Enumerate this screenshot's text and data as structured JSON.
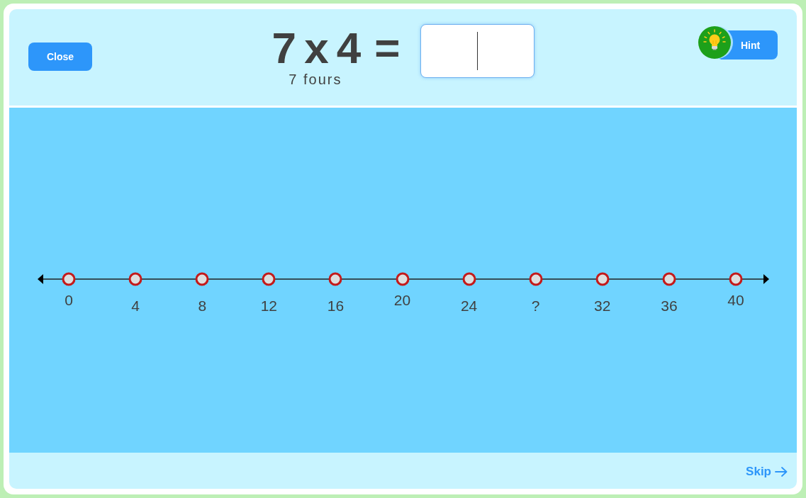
{
  "close_button": {
    "label": "Close"
  },
  "question": {
    "expression": "7 x 4",
    "equals": "=",
    "subtitle": "7 fours"
  },
  "answer_field": {
    "focused": true
  },
  "hint_button": {
    "label": "Hint"
  },
  "number_line": {
    "points": [
      {
        "label": "0",
        "kind": "major"
      },
      {
        "label": "4",
        "kind": "minor"
      },
      {
        "label": "8",
        "kind": "minor"
      },
      {
        "label": "12",
        "kind": "minor"
      },
      {
        "label": "16",
        "kind": "minor"
      },
      {
        "label": "20",
        "kind": "major"
      },
      {
        "label": "24",
        "kind": "minor"
      },
      {
        "label": "?",
        "kind": "minor"
      },
      {
        "label": "32",
        "kind": "minor"
      },
      {
        "label": "36",
        "kind": "minor"
      },
      {
        "label": "40",
        "kind": "major"
      }
    ]
  },
  "skip_link": {
    "label": "Skip"
  }
}
